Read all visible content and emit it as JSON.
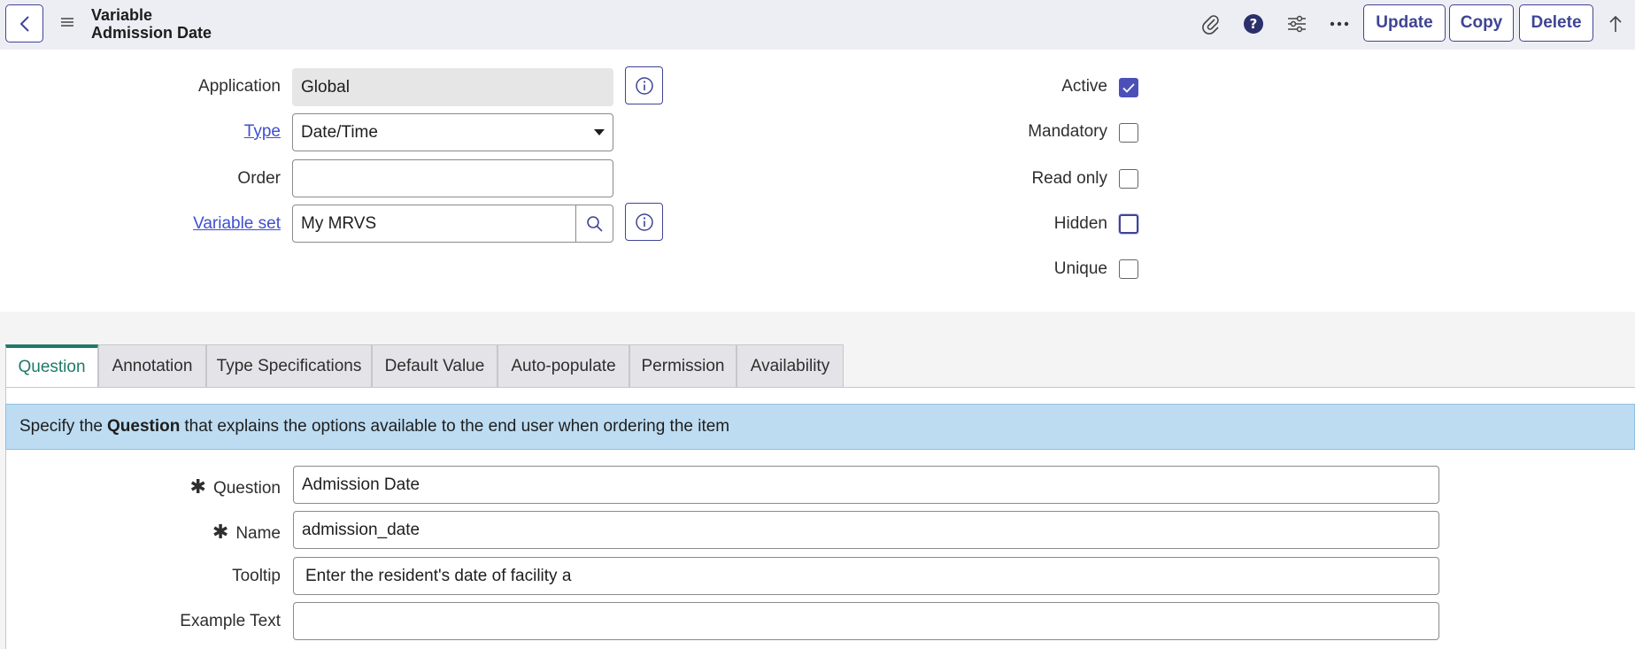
{
  "header": {
    "title_line1": "Variable",
    "title_line2": "Admission Date",
    "buttons": {
      "update": "Update",
      "copy": "Copy",
      "delete": "Delete"
    },
    "icons": [
      "paperclip-icon",
      "help-icon",
      "settings-sliders-icon",
      "more-icon",
      "scroll-up-icon"
    ]
  },
  "form": {
    "application": {
      "label": "Application",
      "value": "Global"
    },
    "type": {
      "label": "Type",
      "value": "Date/Time"
    },
    "order": {
      "label": "Order",
      "value": ""
    },
    "variable_set": {
      "label": "Variable set",
      "value": "My MRVS"
    },
    "flags": {
      "active": {
        "label": "Active",
        "checked": true
      },
      "mandatory": {
        "label": "Mandatory",
        "checked": false
      },
      "read_only": {
        "label": "Read only",
        "checked": false
      },
      "hidden": {
        "label": "Hidden",
        "checked": false
      },
      "unique": {
        "label": "Unique",
        "checked": false
      }
    }
  },
  "tabs": [
    "Question",
    "Annotation",
    "Type Specifications",
    "Default Value",
    "Auto-populate",
    "Permission",
    "Availability"
  ],
  "banner": {
    "prefix": "Specify the",
    "bold": "Question",
    "suffix": "that explains the options available to the end user when ordering the item"
  },
  "question_section": {
    "required_marker": "✱",
    "question": {
      "label": "Question",
      "value": "Admission Date"
    },
    "name": {
      "label": "Name",
      "value": "admission_date"
    },
    "tooltip": {
      "label": "Tooltip",
      "value": "Enter the resident's date of facility a"
    },
    "example_text": {
      "label": "Example Text",
      "value": ""
    }
  },
  "colors": {
    "accent": "#3f4494",
    "active_tab": "#1f7a68",
    "banner": "#bddcf2"
  }
}
